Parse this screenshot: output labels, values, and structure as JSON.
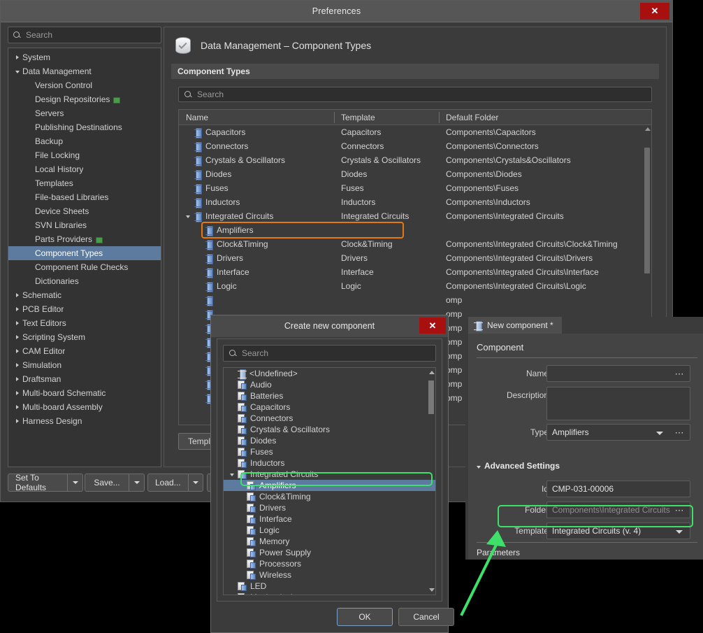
{
  "window": {
    "title": "Preferences",
    "close_label": "✕"
  },
  "sidebar": {
    "search_placeholder": "Search",
    "search_icon": "search-icon",
    "items": [
      {
        "label": "System",
        "level": 0,
        "twisty": "collapsed"
      },
      {
        "label": "Data Management",
        "level": 0,
        "twisty": "expanded"
      },
      {
        "label": "Version Control",
        "level": 1,
        "twisty": "none"
      },
      {
        "label": "Design Repositories",
        "level": 1,
        "twisty": "none",
        "badge": "network-icon"
      },
      {
        "label": "Servers",
        "level": 1,
        "twisty": "none"
      },
      {
        "label": "Publishing Destinations",
        "level": 1,
        "twisty": "none"
      },
      {
        "label": "Backup",
        "level": 1,
        "twisty": "none"
      },
      {
        "label": "File Locking",
        "level": 1,
        "twisty": "none"
      },
      {
        "label": "Local History",
        "level": 1,
        "twisty": "none"
      },
      {
        "label": "Templates",
        "level": 1,
        "twisty": "none"
      },
      {
        "label": "File-based Libraries",
        "level": 1,
        "twisty": "none"
      },
      {
        "label": "Device Sheets",
        "level": 1,
        "twisty": "none"
      },
      {
        "label": "SVN Libraries",
        "level": 1,
        "twisty": "none"
      },
      {
        "label": "Parts Providers",
        "level": 1,
        "twisty": "none",
        "badge": "network-icon"
      },
      {
        "label": "Component Types",
        "level": 1,
        "twisty": "none",
        "selected": true
      },
      {
        "label": "Component Rule Checks",
        "level": 1,
        "twisty": "none"
      },
      {
        "label": "Dictionaries",
        "level": 1,
        "twisty": "none"
      },
      {
        "label": "Schematic",
        "level": 0,
        "twisty": "collapsed"
      },
      {
        "label": "PCB Editor",
        "level": 0,
        "twisty": "collapsed"
      },
      {
        "label": "Text Editors",
        "level": 0,
        "twisty": "collapsed"
      },
      {
        "label": "Scripting System",
        "level": 0,
        "twisty": "collapsed"
      },
      {
        "label": "CAM Editor",
        "level": 0,
        "twisty": "collapsed"
      },
      {
        "label": "Simulation",
        "level": 0,
        "twisty": "collapsed"
      },
      {
        "label": "Draftsman",
        "level": 0,
        "twisty": "collapsed"
      },
      {
        "label": "Multi-board Schematic",
        "level": 0,
        "twisty": "collapsed"
      },
      {
        "label": "Multi-board Assembly",
        "level": 0,
        "twisty": "collapsed"
      },
      {
        "label": "Harness Design",
        "level": 0,
        "twisty": "collapsed"
      }
    ]
  },
  "content": {
    "page_icon": "database-check-icon",
    "title": "Data Management – Component Types",
    "section_title": "Component Types",
    "search_placeholder": "Search",
    "table": {
      "columns": [
        "Name",
        "Template",
        "Default Folder"
      ],
      "rows": [
        {
          "name": "Capacitors",
          "template": "Capacitors",
          "folder": "Components\\Capacitors",
          "indent": 1,
          "twisty": "none"
        },
        {
          "name": "Connectors",
          "template": "Connectors",
          "folder": "Components\\Connectors",
          "indent": 1,
          "twisty": "none"
        },
        {
          "name": "Crystals & Oscillators",
          "template": "Crystals & Oscillators",
          "folder": "Components\\Crystals&Oscillators",
          "indent": 1,
          "twisty": "none"
        },
        {
          "name": "Diodes",
          "template": "Diodes",
          "folder": "Components\\Diodes",
          "indent": 1,
          "twisty": "none"
        },
        {
          "name": "Fuses",
          "template": "Fuses",
          "folder": "Components\\Fuses",
          "indent": 1,
          "twisty": "none"
        },
        {
          "name": "Inductors",
          "template": "Inductors",
          "folder": "Components\\Inductors",
          "indent": 1,
          "twisty": "none"
        },
        {
          "name": "Integrated Circuits",
          "template": "Integrated Circuits",
          "folder": "Components\\Integrated Circuits",
          "indent": 1,
          "twisty": "expanded"
        },
        {
          "name": "Amplifiers",
          "template": "",
          "folder": "",
          "indent": 2,
          "twisty": "none",
          "highlight": "orange"
        },
        {
          "name": "Clock&Timing",
          "template": "Clock&Timing",
          "folder": "Components\\Integrated Circuits\\Clock&Timing",
          "indent": 2,
          "twisty": "none"
        },
        {
          "name": "Drivers",
          "template": "Drivers",
          "folder": "Components\\Integrated Circuits\\Drivers",
          "indent": 2,
          "twisty": "none"
        },
        {
          "name": "Interface",
          "template": "Interface",
          "folder": "Components\\Integrated Circuits\\Interface",
          "indent": 2,
          "twisty": "none"
        },
        {
          "name": "Logic",
          "template": "Logic",
          "folder": "Components\\Integrated Circuits\\Logic",
          "indent": 2,
          "twisty": "none"
        }
      ],
      "obscured_rows": [
        {
          "folder_fragment": "omp"
        },
        {
          "folder_fragment": "omp"
        },
        {
          "folder_fragment": "omp"
        },
        {
          "folder_fragment": "omp"
        },
        {
          "folder_fragment": "omp"
        },
        {
          "folder_fragment": "omp"
        },
        {
          "folder_fragment": "omp"
        },
        {
          "folder_fragment": "omp"
        }
      ]
    },
    "template_button": "Templ"
  },
  "footer": {
    "buttons": [
      {
        "label": "Set To Defaults"
      },
      {
        "label": "Save..."
      },
      {
        "label": "Load..."
      }
    ]
  },
  "dialog": {
    "title": "Create new component",
    "close_label": "✕",
    "search_placeholder": "Search",
    "tree": [
      {
        "label": "<Undefined>",
        "indent": 1,
        "icon": "chip-icon",
        "twisty": "none"
      },
      {
        "label": "Audio",
        "indent": 1,
        "icon": "doc-chip-icon",
        "twisty": "none"
      },
      {
        "label": "Batteries",
        "indent": 1,
        "icon": "doc-chip-icon",
        "twisty": "none"
      },
      {
        "label": "Capacitors",
        "indent": 1,
        "icon": "doc-chip-icon",
        "twisty": "none"
      },
      {
        "label": "Connectors",
        "indent": 1,
        "icon": "doc-chip-icon",
        "twisty": "none"
      },
      {
        "label": "Crystals & Oscillators",
        "indent": 1,
        "icon": "doc-chip-icon",
        "twisty": "none"
      },
      {
        "label": "Diodes",
        "indent": 1,
        "icon": "doc-chip-icon",
        "twisty": "none"
      },
      {
        "label": "Fuses",
        "indent": 1,
        "icon": "doc-chip-icon",
        "twisty": "none"
      },
      {
        "label": "Inductors",
        "indent": 1,
        "icon": "doc-chip-icon",
        "twisty": "none"
      },
      {
        "label": "Integrated Circuits",
        "indent": 1,
        "icon": "doc-chip-icon",
        "twisty": "expanded"
      },
      {
        "label": "Amplifiers",
        "indent": 2,
        "icon": "doc-chip-icon",
        "twisty": "none",
        "selected": true,
        "highlight": "green"
      },
      {
        "label": "Clock&Timing",
        "indent": 2,
        "icon": "doc-chip-icon",
        "twisty": "none"
      },
      {
        "label": "Drivers",
        "indent": 2,
        "icon": "doc-chip-icon",
        "twisty": "none"
      },
      {
        "label": "Interface",
        "indent": 2,
        "icon": "doc-chip-icon",
        "twisty": "none"
      },
      {
        "label": "Logic",
        "indent": 2,
        "icon": "doc-chip-icon",
        "twisty": "none"
      },
      {
        "label": "Memory",
        "indent": 2,
        "icon": "doc-chip-icon",
        "twisty": "none"
      },
      {
        "label": "Power Supply",
        "indent": 2,
        "icon": "doc-chip-icon",
        "twisty": "none"
      },
      {
        "label": "Processors",
        "indent": 2,
        "icon": "doc-chip-icon",
        "twisty": "none"
      },
      {
        "label": "Wireless",
        "indent": 2,
        "icon": "doc-chip-icon",
        "twisty": "none"
      },
      {
        "label": "LED",
        "indent": 1,
        "icon": "doc-chip-icon",
        "twisty": "none"
      },
      {
        "label": "Mechanical",
        "indent": 1,
        "icon": "doc-chip-icon",
        "twisty": "none"
      }
    ],
    "ok_label": "OK",
    "cancel_label": "Cancel"
  },
  "new_component": {
    "tab_label": "New component *",
    "tab_icon": "chip-icon",
    "section_label": "Component",
    "fields": {
      "name_label": "Name",
      "name_value": "",
      "description_label": "Description",
      "description_value": "",
      "type_label": "Type",
      "type_value": "Amplifiers",
      "advanced_label": "Advanced Settings",
      "id_label": "Id",
      "id_value": "CMP-031-00006",
      "folder_label": "Folder",
      "folder_value": "Components\\Integrated Circuits",
      "template_label": "Template",
      "template_value": "Integrated Circuits (v. 4)"
    },
    "parameters_label": "Parameters"
  },
  "annotations": {
    "highlight_green": "#3ee06a",
    "highlight_orange": "#e8770f",
    "arrow_color": "#3ee06a"
  }
}
